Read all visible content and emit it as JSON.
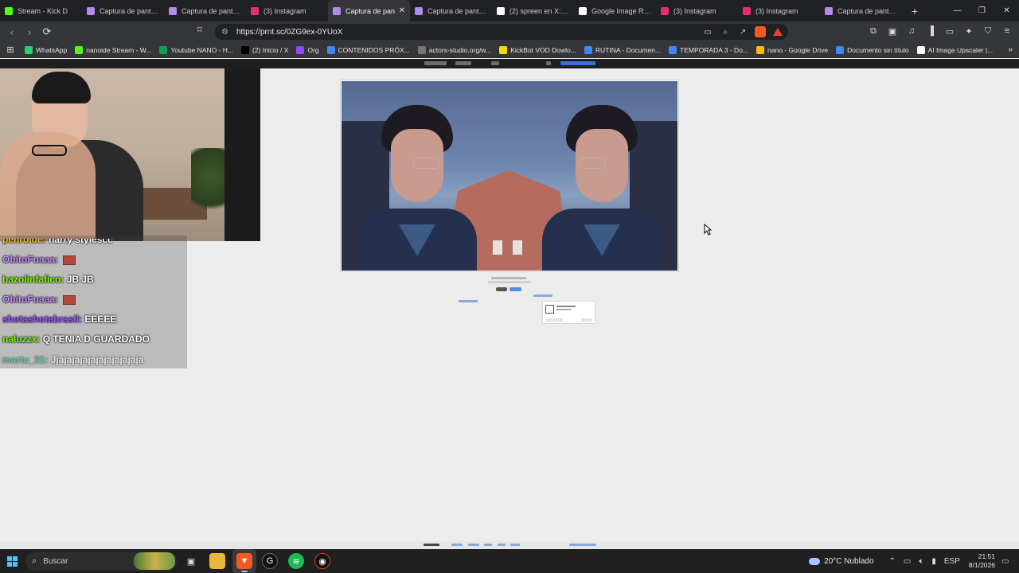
{
  "browser": {
    "tabs": [
      {
        "label": "Stream - Kick D",
        "icon": "kick-icon",
        "color": "#53fc18",
        "active": false
      },
      {
        "label": "Captura de pantalla",
        "icon": "lightshot-feather-icon",
        "color": "#b08be8",
        "active": false
      },
      {
        "label": "Captura de pantalla",
        "icon": "lightshot-feather-icon",
        "color": "#b08be8",
        "active": false
      },
      {
        "label": "(3) Instagram",
        "icon": "instagram-icon",
        "color": "#e1306c",
        "active": false
      },
      {
        "label": "Captura de pan",
        "icon": "lightshot-feather-icon",
        "color": "#b08be8",
        "active": true
      },
      {
        "label": "Captura de pantalla",
        "icon": "lightshot-feather-icon",
        "color": "#b08be8",
        "active": false
      },
      {
        "label": "(2) spreen en X: \"ag",
        "icon": "x-icon",
        "color": "#ffffff",
        "active": false
      },
      {
        "label": "Google Image Resu",
        "icon": "google-icon",
        "color": "#ffffff",
        "active": false
      },
      {
        "label": "(3) Instagram",
        "icon": "instagram-icon",
        "color": "#e1306c",
        "active": false
      },
      {
        "label": "(3) Instagram",
        "icon": "instagram-icon",
        "color": "#e1306c",
        "active": false
      },
      {
        "label": "Captura de pantalla",
        "icon": "lightshot-feather-icon",
        "color": "#b08be8",
        "active": false
      }
    ],
    "new_tab_label": "+",
    "url": "https://prnt.sc/0ZG9ex-0YUoX",
    "bookmarks": [
      {
        "label": "WhatsApp",
        "icon": "whatsapp-icon",
        "color": "#25d366"
      },
      {
        "label": "nanoide Stream - W...",
        "icon": "kick-icon",
        "color": "#53fc18"
      },
      {
        "label": "Youtube NANO - H...",
        "icon": "sheets-icon",
        "color": "#0f9d58"
      },
      {
        "label": "(2) Inicio / X",
        "icon": "x-icon",
        "color": "#000000"
      },
      {
        "label": "Org",
        "icon": "twitch-icon",
        "color": "#9146ff"
      },
      {
        "label": "CONTENIDOS PRÓX...",
        "icon": "docs-icon",
        "color": "#4285f4"
      },
      {
        "label": "actors-studio.org/w...",
        "icon": "globe-icon",
        "color": "#777777"
      },
      {
        "label": "KickBot VOD Dowlo...",
        "icon": "kickbot-icon",
        "color": "#f5d90a"
      },
      {
        "label": "RUTINA - Documen...",
        "icon": "docs-icon",
        "color": "#4285f4"
      },
      {
        "label": "TEMPORADA 3 - Do...",
        "icon": "docs-icon",
        "color": "#4285f4"
      },
      {
        "label": "nano - Google Drive",
        "icon": "drive-icon",
        "color": "#fbbc04"
      },
      {
        "label": "Documento sin título",
        "icon": "docs-icon",
        "color": "#4285f4"
      },
      {
        "label": "AI Image Upscaler |...",
        "icon": "ai-icon",
        "color": "#ffffff"
      }
    ]
  },
  "stream_overlay": {
    "chat": [
      {
        "user": "penroide:",
        "message": "harry stylescc",
        "color": "#f0c020",
        "partial": true
      },
      {
        "user": "ObitoFuaaa:",
        "message": "",
        "color": "#c48cff",
        "emote": true
      },
      {
        "user": "bazolinfafico:",
        "message": "JB JB",
        "color": "#7cfc00"
      },
      {
        "user": "ObitoFuaaa:",
        "message": "",
        "color": "#c48cff",
        "emote": true
      },
      {
        "user": "shotashotabrasil:",
        "message": "EEEEE",
        "color": "#9b59ff"
      },
      {
        "user": "naluzzx:",
        "message": "Q TENIA D GUARDADO",
        "color": "#7cfc00"
      },
      {
        "user": "martu_31:",
        "message": "Jjajajajajajajajajajaja",
        "color": "#2ec4a6",
        "faded": true
      }
    ]
  },
  "taskbar": {
    "search_placeholder": "Buscar",
    "weather": "20°C  Nublado",
    "language": "ESP",
    "time": "21:51",
    "date": "8/1/2026"
  }
}
